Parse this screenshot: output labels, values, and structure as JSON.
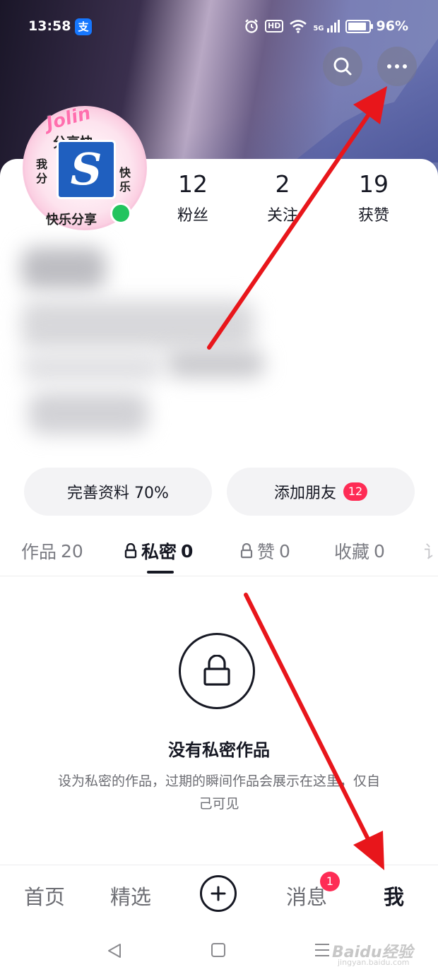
{
  "status_bar": {
    "time": "13:58",
    "alipay_icon_text": "支",
    "hd_label": "HD",
    "network": "5G",
    "battery": "96%"
  },
  "header": {
    "search_icon": "search-icon",
    "more_icon": "more-dots-icon"
  },
  "avatar": {
    "top_text": "Jolin",
    "ring_text_top": "分享快",
    "ring_text_left": "我分",
    "ring_text_right": "快乐",
    "ring_text_bottom": "快乐分享",
    "logo_letter": "S"
  },
  "stats": [
    {
      "value": "12",
      "label": "粉丝"
    },
    {
      "value": "2",
      "label": "关注"
    },
    {
      "value": "19",
      "label": "获赞"
    }
  ],
  "actions": {
    "complete_profile": "完善资料 70%",
    "add_friend": "添加朋友",
    "add_friend_badge": "12"
  },
  "tabs": [
    {
      "label": "作品",
      "count": "20",
      "locked": false,
      "active": false
    },
    {
      "label": "私密",
      "count": "0",
      "locked": true,
      "active": true
    },
    {
      "label": "赞",
      "count": "0",
      "locked": true,
      "active": false
    },
    {
      "label": "收藏",
      "count": "0",
      "locked": false,
      "active": false
    },
    {
      "label": "讠",
      "count": "",
      "locked": false,
      "active": false
    }
  ],
  "empty_state": {
    "title": "没有私密作品",
    "description": "设为私密的作品，过期的瞬间作品会展示在这里，仅自己可见"
  },
  "bottom_nav": {
    "home": "首页",
    "featured": "精选",
    "messages": "消息",
    "messages_badge": "1",
    "me": "我"
  },
  "watermark": {
    "brand": "Baidu经验",
    "url": "jingyan.baidu.com"
  },
  "colors": {
    "accent_red": "#fe2c55",
    "online_green": "#22c45e",
    "text_primary": "#161823",
    "annotation_arrow": "#e8161b"
  }
}
